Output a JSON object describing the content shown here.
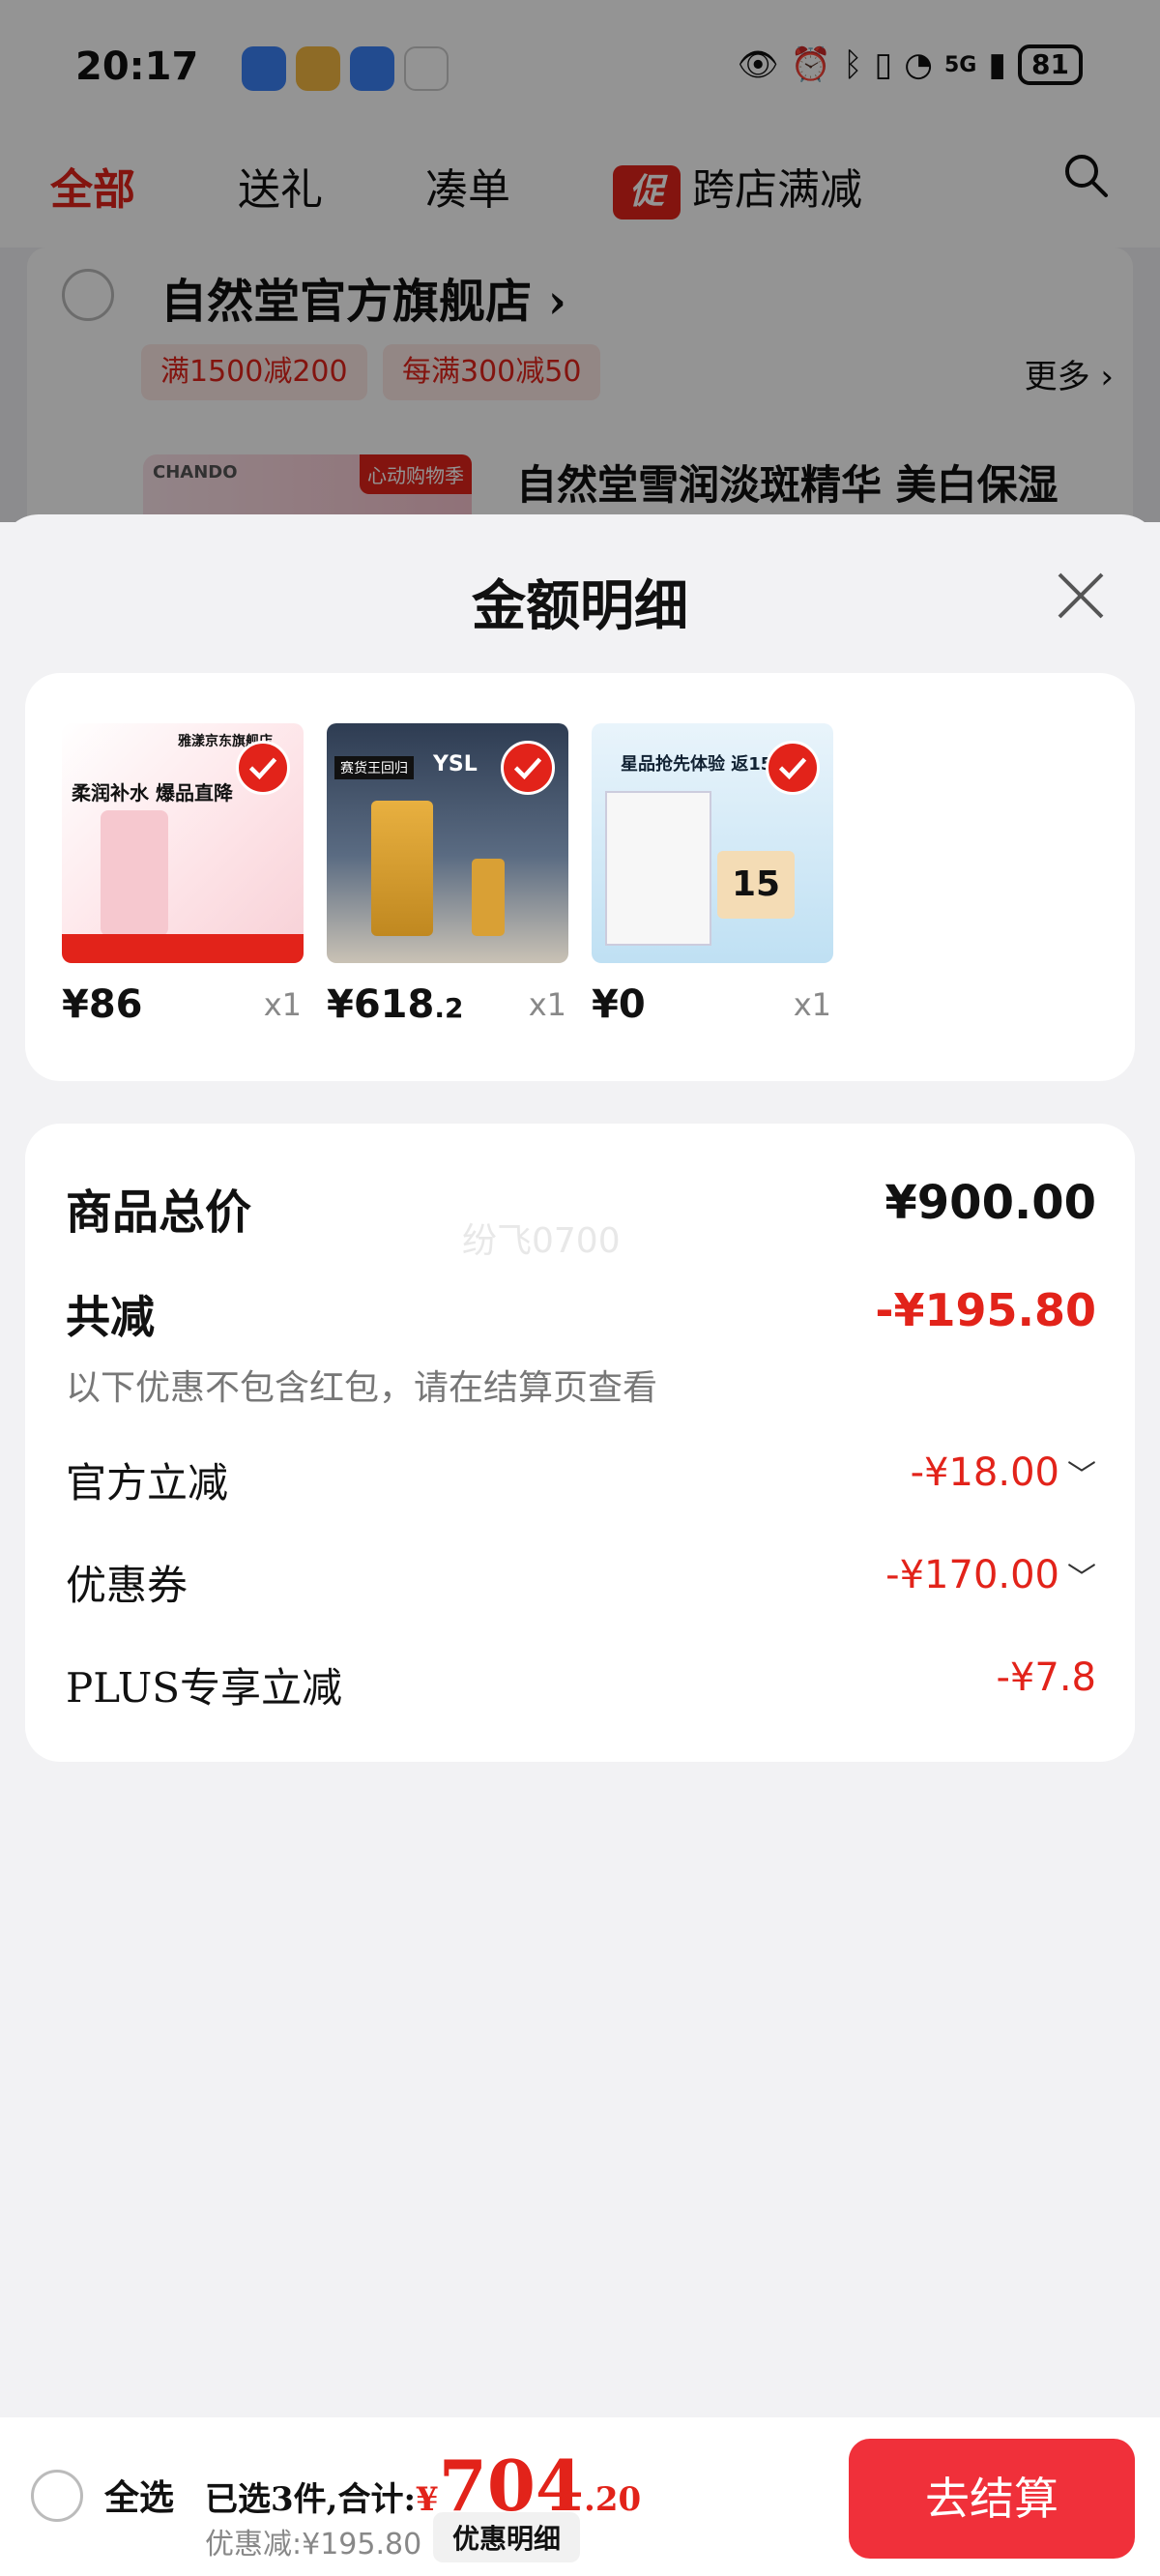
{
  "status_bar": {
    "time": "20:17",
    "battery": "81",
    "network": "5G"
  },
  "tabs": [
    {
      "label": "全部",
      "active": true
    },
    {
      "label": "送礼",
      "active": false
    },
    {
      "label": "凑单",
      "active": false
    },
    {
      "label": "跨店满减",
      "active": false,
      "badge": "促"
    }
  ],
  "store": {
    "name": "自然堂官方旗舰店",
    "coupons": [
      "满1500减200",
      "每满300减50"
    ],
    "more": "更多",
    "product_title": "自然堂雪润淡斑精华 美白保湿",
    "thumb_brand": "CHANDO",
    "thumb_tag": "心动购物季"
  },
  "sheet": {
    "title": "金额明细",
    "items": [
      {
        "price_main": "¥86",
        "price_dec": "",
        "qty": "x1",
        "img_text": "柔润补水 爆品直降",
        "store_text": "雅漾京东旗舰店"
      },
      {
        "price_main": "¥618",
        "price_dec": ".2",
        "qty": "x1",
        "img_text": "YSL",
        "store_text": "赛货王回归"
      },
      {
        "price_main": "¥0",
        "price_dec": "",
        "qty": "x1",
        "img_text": "星品抢先体验 返15元",
        "store_text": "15"
      }
    ],
    "summary": {
      "total_label": "商品总价",
      "total_value": "¥900.00",
      "reduce_label": "共减",
      "reduce_value": "-¥195.80",
      "note": "以下优惠不包含红包，请在结算页查看",
      "rows": [
        {
          "label": "官方立减",
          "value": "-¥18.00"
        },
        {
          "label": "优惠券",
          "value": "-¥170.00"
        },
        {
          "label": "PLUS专享立减",
          "value": "-¥7.8"
        }
      ],
      "watermark": "纷飞0700"
    }
  },
  "bottom_bar": {
    "select_all": "全选",
    "selected_text": "已选3件,合计:",
    "currency": "¥",
    "total_int": "704",
    "total_dec": ".20",
    "discount_text": "优惠减:¥195.80",
    "detail_button": "优惠明细",
    "checkout": "去结算"
  },
  "colors": {
    "accent": "#e2231a",
    "checkout": "#f0303a"
  }
}
